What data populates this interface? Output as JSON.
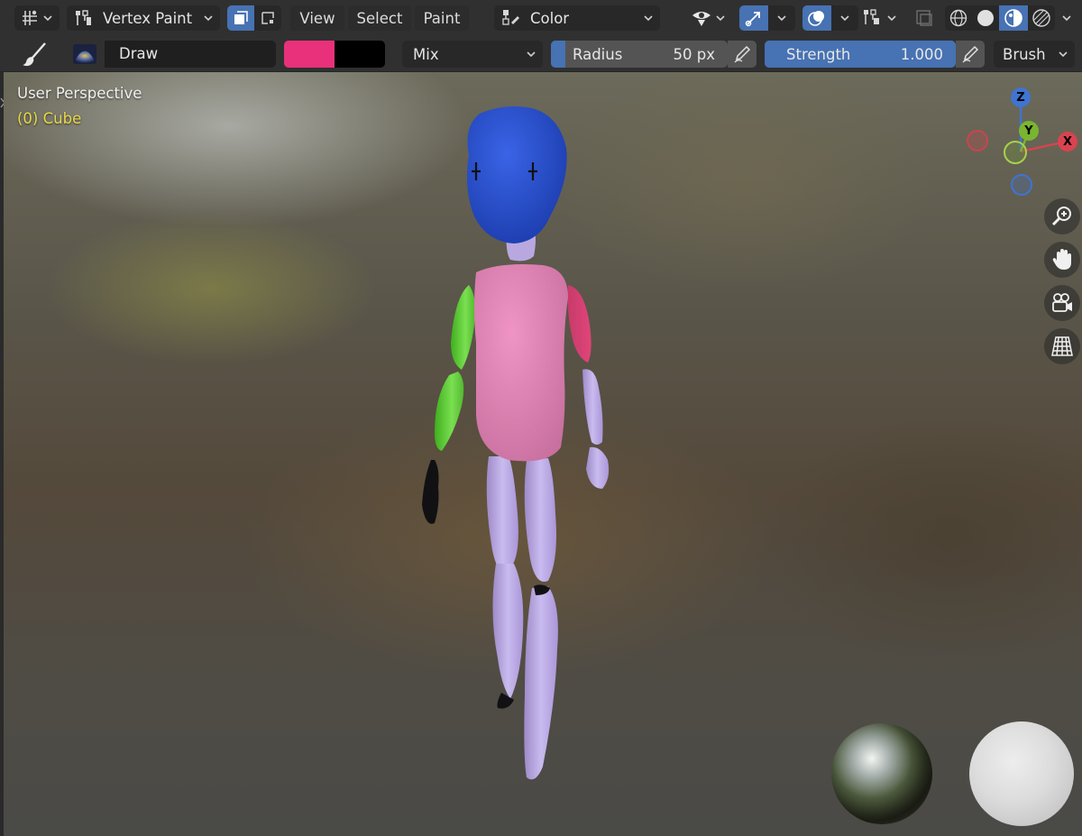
{
  "header": {
    "editor_type_icon": "grid-axis-icon",
    "mode": {
      "icon": "vertex-paint-icon",
      "label": "Vertex Paint"
    },
    "menus": [
      "View",
      "Select",
      "Paint"
    ],
    "color_attribute": {
      "icon": "color-attribute-icon",
      "label": "Color"
    },
    "right_icons": [
      "visibility-eye-icon",
      "gizmo-arrow-icon",
      "overlays-icon",
      "mesh-edit-icon",
      "xray-icon",
      "wireframe-shading-icon",
      "solid-shading-icon",
      "material-preview-icon",
      "rendered-shading-icon"
    ]
  },
  "tool_settings": {
    "brush_name": "Draw",
    "primary_color": "#e8317a",
    "secondary_color": "#000000",
    "blend_mode": "Mix",
    "radius": {
      "label": "Radius",
      "value": "50 px"
    },
    "strength": {
      "label": "Strength",
      "value": "1.000",
      "fraction": 1.0
    },
    "brush_menu": "Brush"
  },
  "viewport": {
    "view_name": "User Perspective",
    "object_name": "(0) Cube",
    "gizmo_axes": [
      "Z",
      "Y",
      "X"
    ],
    "nav_buttons": [
      "zoom-icon",
      "hand-pan-icon",
      "camera-icon",
      "ortho-grid-icon"
    ]
  },
  "colors": {
    "accent": "#4772b3",
    "object_label": "#e8d84a",
    "axis_x": "#d9434f",
    "axis_y": "#7ab52f",
    "axis_z": "#3f74d1"
  }
}
